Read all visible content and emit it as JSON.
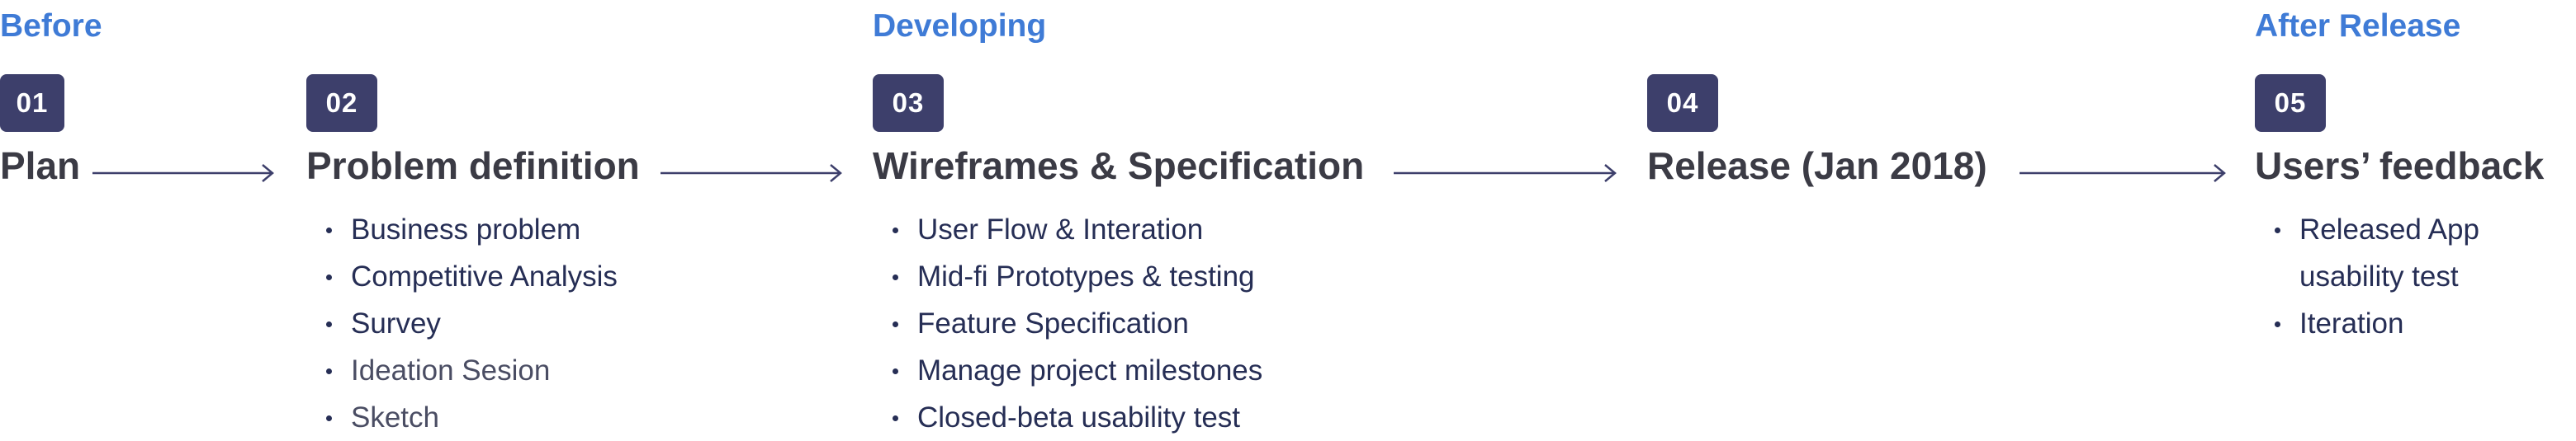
{
  "phases": {
    "before": "Before",
    "developing": "Developing",
    "after": "After Release"
  },
  "steps": [
    {
      "number": "01",
      "title": "Plan",
      "items": []
    },
    {
      "number": "02",
      "title": "Problem definition",
      "items": [
        "Business problem",
        "Competitive Analysis",
        "Survey",
        "Ideation Sesion",
        "Sketch"
      ]
    },
    {
      "number": "03",
      "title": "Wireframes & Specification",
      "items": [
        "User Flow & Interation",
        "Mid-fi Prototypes & testing",
        "Feature Specification",
        "Manage project milestones",
        "Closed-beta usability test"
      ]
    },
    {
      "number": "04",
      "title": "Release (Jan 2018)",
      "items": []
    },
    {
      "number": "05",
      "title": "Users’ feedback",
      "items": [
        "Released App",
        "usability test",
        "Iteration"
      ]
    }
  ],
  "colors": {
    "phase_label": "#3f7bd6",
    "badge": "#3d3f6b",
    "arrow": "#3d3f6b",
    "text": "#3b3b45"
  }
}
